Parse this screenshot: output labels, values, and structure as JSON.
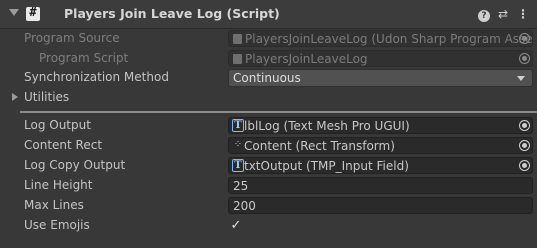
{
  "header": {
    "title": "Players Join Leave Log (Script)",
    "script_icon": "#",
    "help_icon": "?",
    "presets_icon": "⇄",
    "more_icon": "⋮"
  },
  "program_source": {
    "label": "Program Source",
    "value": "PlayersJoinLeaveLog (Udon Sharp Program Asse"
  },
  "program_script": {
    "label": "Program Script",
    "value": "PlayersJoinLeaveLog"
  },
  "sync_method": {
    "label": "Synchronization Method",
    "value": "Continuous"
  },
  "utilities": {
    "label": "Utilities"
  },
  "fields": {
    "log_output": {
      "label": "Log Output",
      "value": "lblLog (Text Mesh Pro UGUI)",
      "icon": "T"
    },
    "content_rect": {
      "label": "Content Rect",
      "value": "Content (Rect Transform)",
      "icon": "⁘"
    },
    "log_copy_output": {
      "label": "Log Copy Output",
      "value": "txtOutput (TMP_Input Field)",
      "icon": "T"
    },
    "line_height": {
      "label": "Line Height",
      "value": "25"
    },
    "max_lines": {
      "label": "Max Lines",
      "value": "200"
    },
    "use_emojis": {
      "label": "Use Emojis",
      "checked": true,
      "check_glyph": "✓"
    }
  }
}
